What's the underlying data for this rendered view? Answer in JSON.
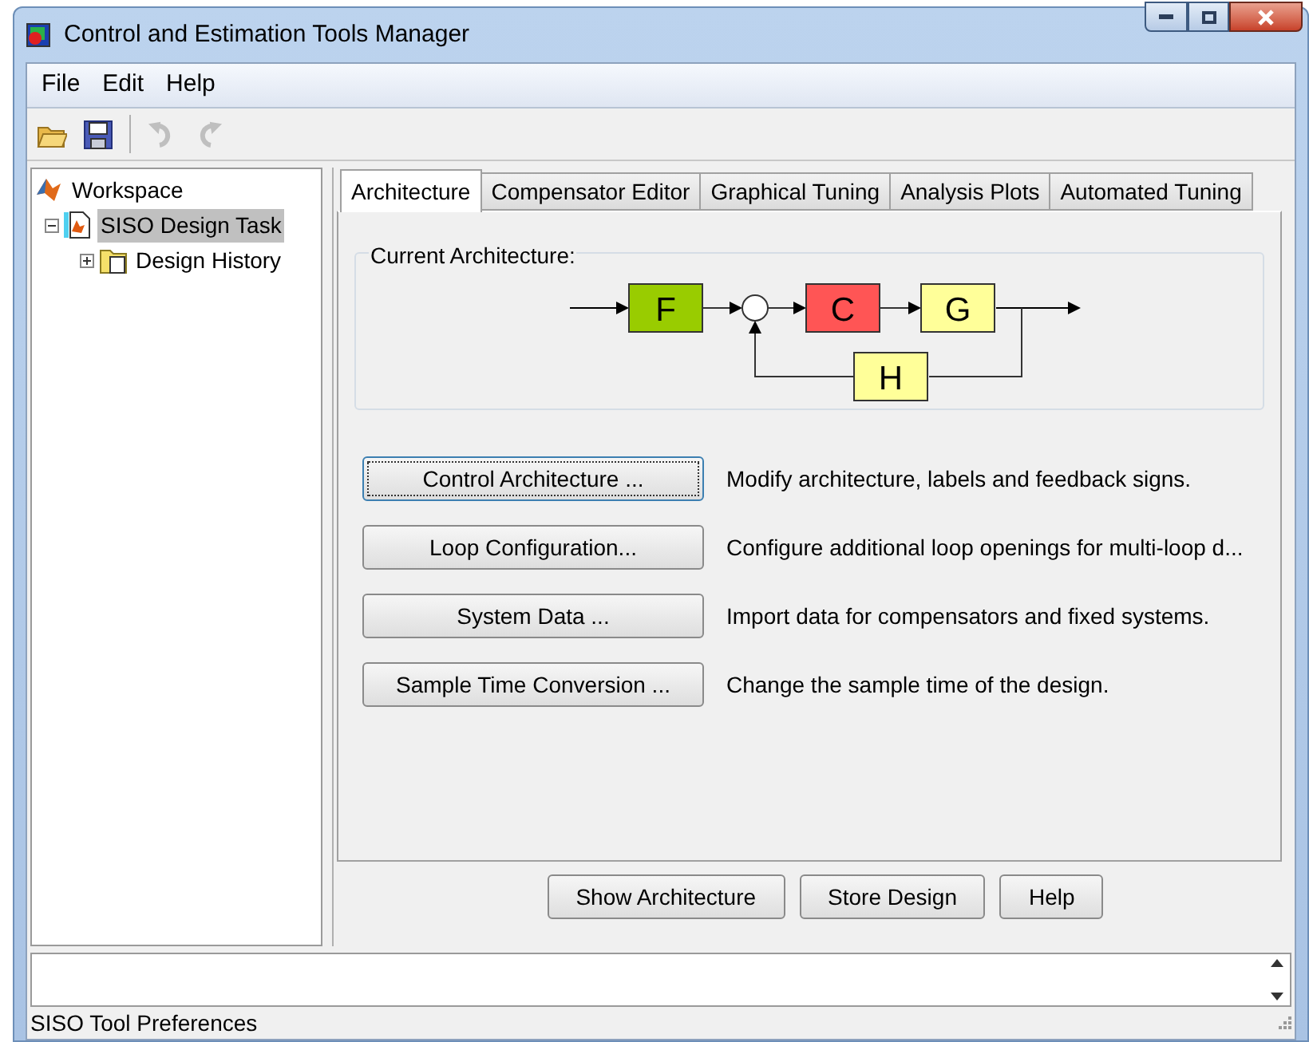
{
  "window": {
    "title": "Control and Estimation Tools Manager"
  },
  "menu": [
    "File",
    "Edit",
    "Help"
  ],
  "toolbar": [
    {
      "kind": "open",
      "disabled": false
    },
    {
      "kind": "save",
      "disabled": false
    },
    {
      "kind": "undo",
      "disabled": true
    },
    {
      "kind": "redo",
      "disabled": true
    }
  ],
  "tree": [
    {
      "label": "Workspace",
      "selected": false,
      "children": [
        {
          "label": "SISO Design Task",
          "selected": true,
          "expanded": true,
          "children": [
            {
              "label": "Design History",
              "selected": false,
              "expanded": false
            }
          ]
        }
      ]
    }
  ],
  "tabs": [
    {
      "label": "Architecture",
      "selected": true
    },
    {
      "label": "Compensator Editor",
      "selected": false
    },
    {
      "label": "Graphical Tuning",
      "selected": false
    },
    {
      "label": "Analysis Plots",
      "selected": false
    },
    {
      "label": "Automated Tuning",
      "selected": false
    }
  ],
  "architecture": {
    "title": "Current Architecture:",
    "blocks": [
      {
        "label": "F",
        "color": "#99cc00"
      },
      {
        "label": "C",
        "color": "#ff5555"
      },
      {
        "label": "G",
        "color": "#ffff99"
      },
      {
        "label": "H",
        "color": "#ffff99"
      }
    ]
  },
  "actions": [
    {
      "button": "Control Architecture ...",
      "description": "Modify architecture, labels and feedback signs.",
      "focused": true
    },
    {
      "button": "Loop Configuration...",
      "description": "Configure additional loop openings for multi-loop d...",
      "focused": false
    },
    {
      "button": "System Data ...",
      "description": "Import data for compensators and fixed systems.",
      "focused": false
    },
    {
      "button": "Sample Time Conversion ...",
      "description": "Change the sample time of the design.",
      "focused": false
    }
  ],
  "buttons": [
    "Show Architecture",
    "Store Design",
    "Help"
  ],
  "status_bar": "SISO Tool Preferences"
}
